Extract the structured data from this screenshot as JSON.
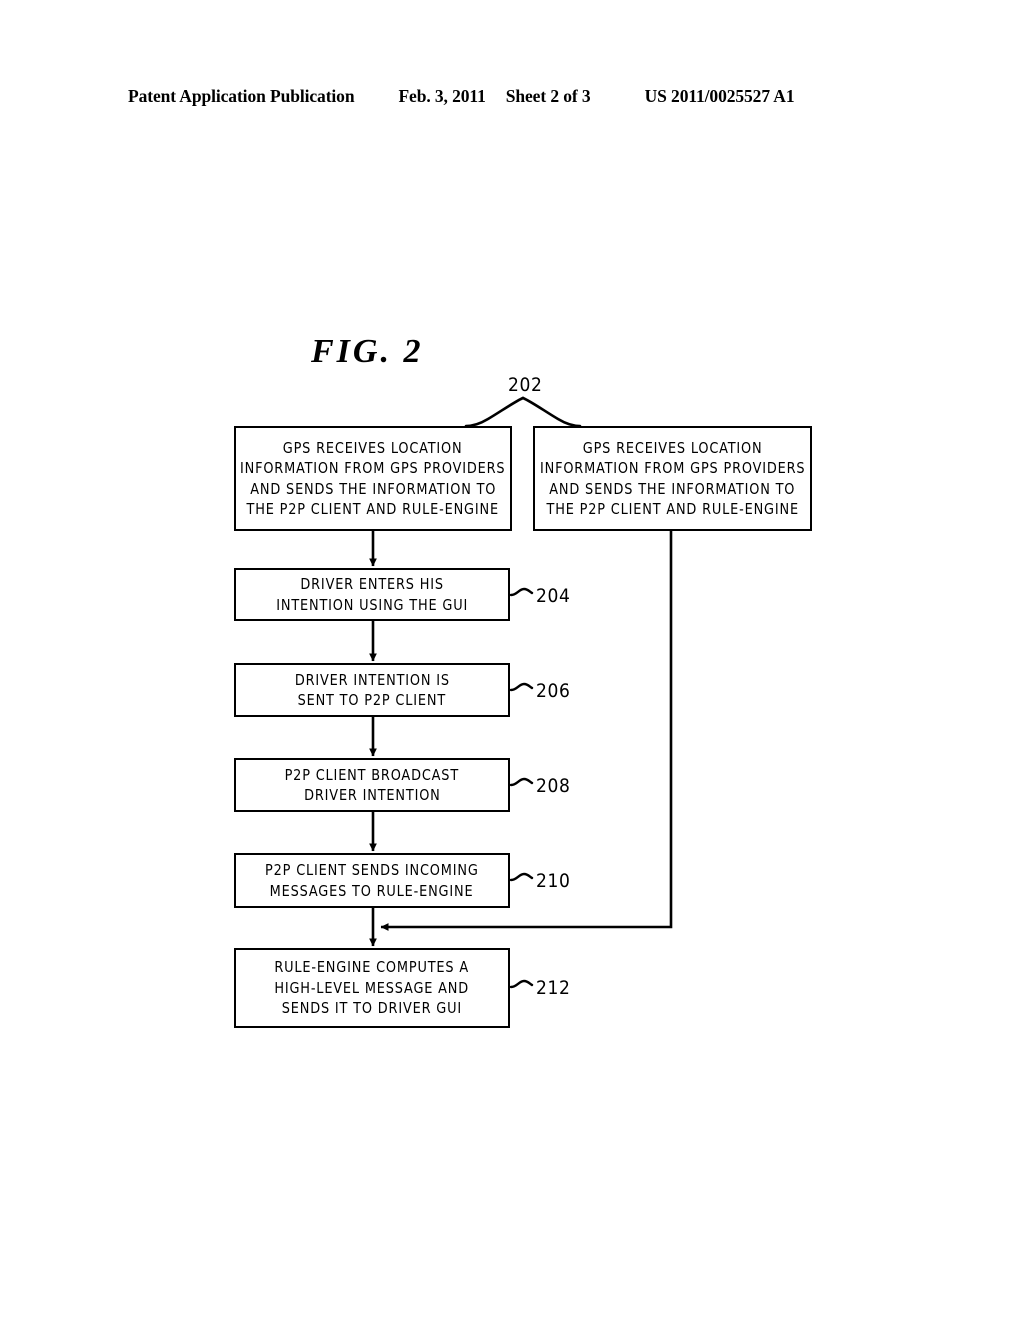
{
  "header": {
    "publication": "Patent Application Publication",
    "date": "Feb. 3, 2011",
    "sheet": "Sheet 2 of 3",
    "publication_number": "US 2011/0025527 A1"
  },
  "figure": {
    "title": "FIG.  2"
  },
  "diagram": {
    "type": "flowchart",
    "boxes": [
      {
        "ref": "202",
        "variant": "left",
        "lines": [
          "GPS RECEIVES LOCATION",
          "INFORMATION FROM GPS PROVIDERS",
          "AND SENDS THE INFORMATION TO",
          "THE P2P CLIENT AND RULE-ENGINE"
        ]
      },
      {
        "ref": "202",
        "variant": "right",
        "lines": [
          "GPS RECEIVES LOCATION",
          "INFORMATION FROM GPS PROVIDERS",
          "AND SENDS THE INFORMATION TO",
          "THE P2P CLIENT AND RULE-ENGINE"
        ]
      },
      {
        "ref": "204",
        "lines": [
          "DRIVER ENTERS HIS",
          "INTENTION USING THE GUI"
        ]
      },
      {
        "ref": "206",
        "lines": [
          "DRIVER INTENTION IS",
          "SENT TO P2P CLIENT"
        ]
      },
      {
        "ref": "208",
        "lines": [
          "P2P CLIENT BROADCAST",
          "DRIVER INTENTION"
        ]
      },
      {
        "ref": "210",
        "lines": [
          "P2P CLIENT SENDS INCOMING",
          "MESSAGES TO RULE-ENGINE"
        ]
      },
      {
        "ref": "212",
        "lines": [
          "RULE-ENGINE COMPUTES A",
          "HIGH-LEVEL MESSAGE AND",
          "SENDS IT TO DRIVER GUI"
        ]
      }
    ],
    "reference_numerals": {
      "n202": "202",
      "n204": "204",
      "n206": "206",
      "n208": "208",
      "n210": "210",
      "n212": "212"
    },
    "line_color": "#000000"
  }
}
